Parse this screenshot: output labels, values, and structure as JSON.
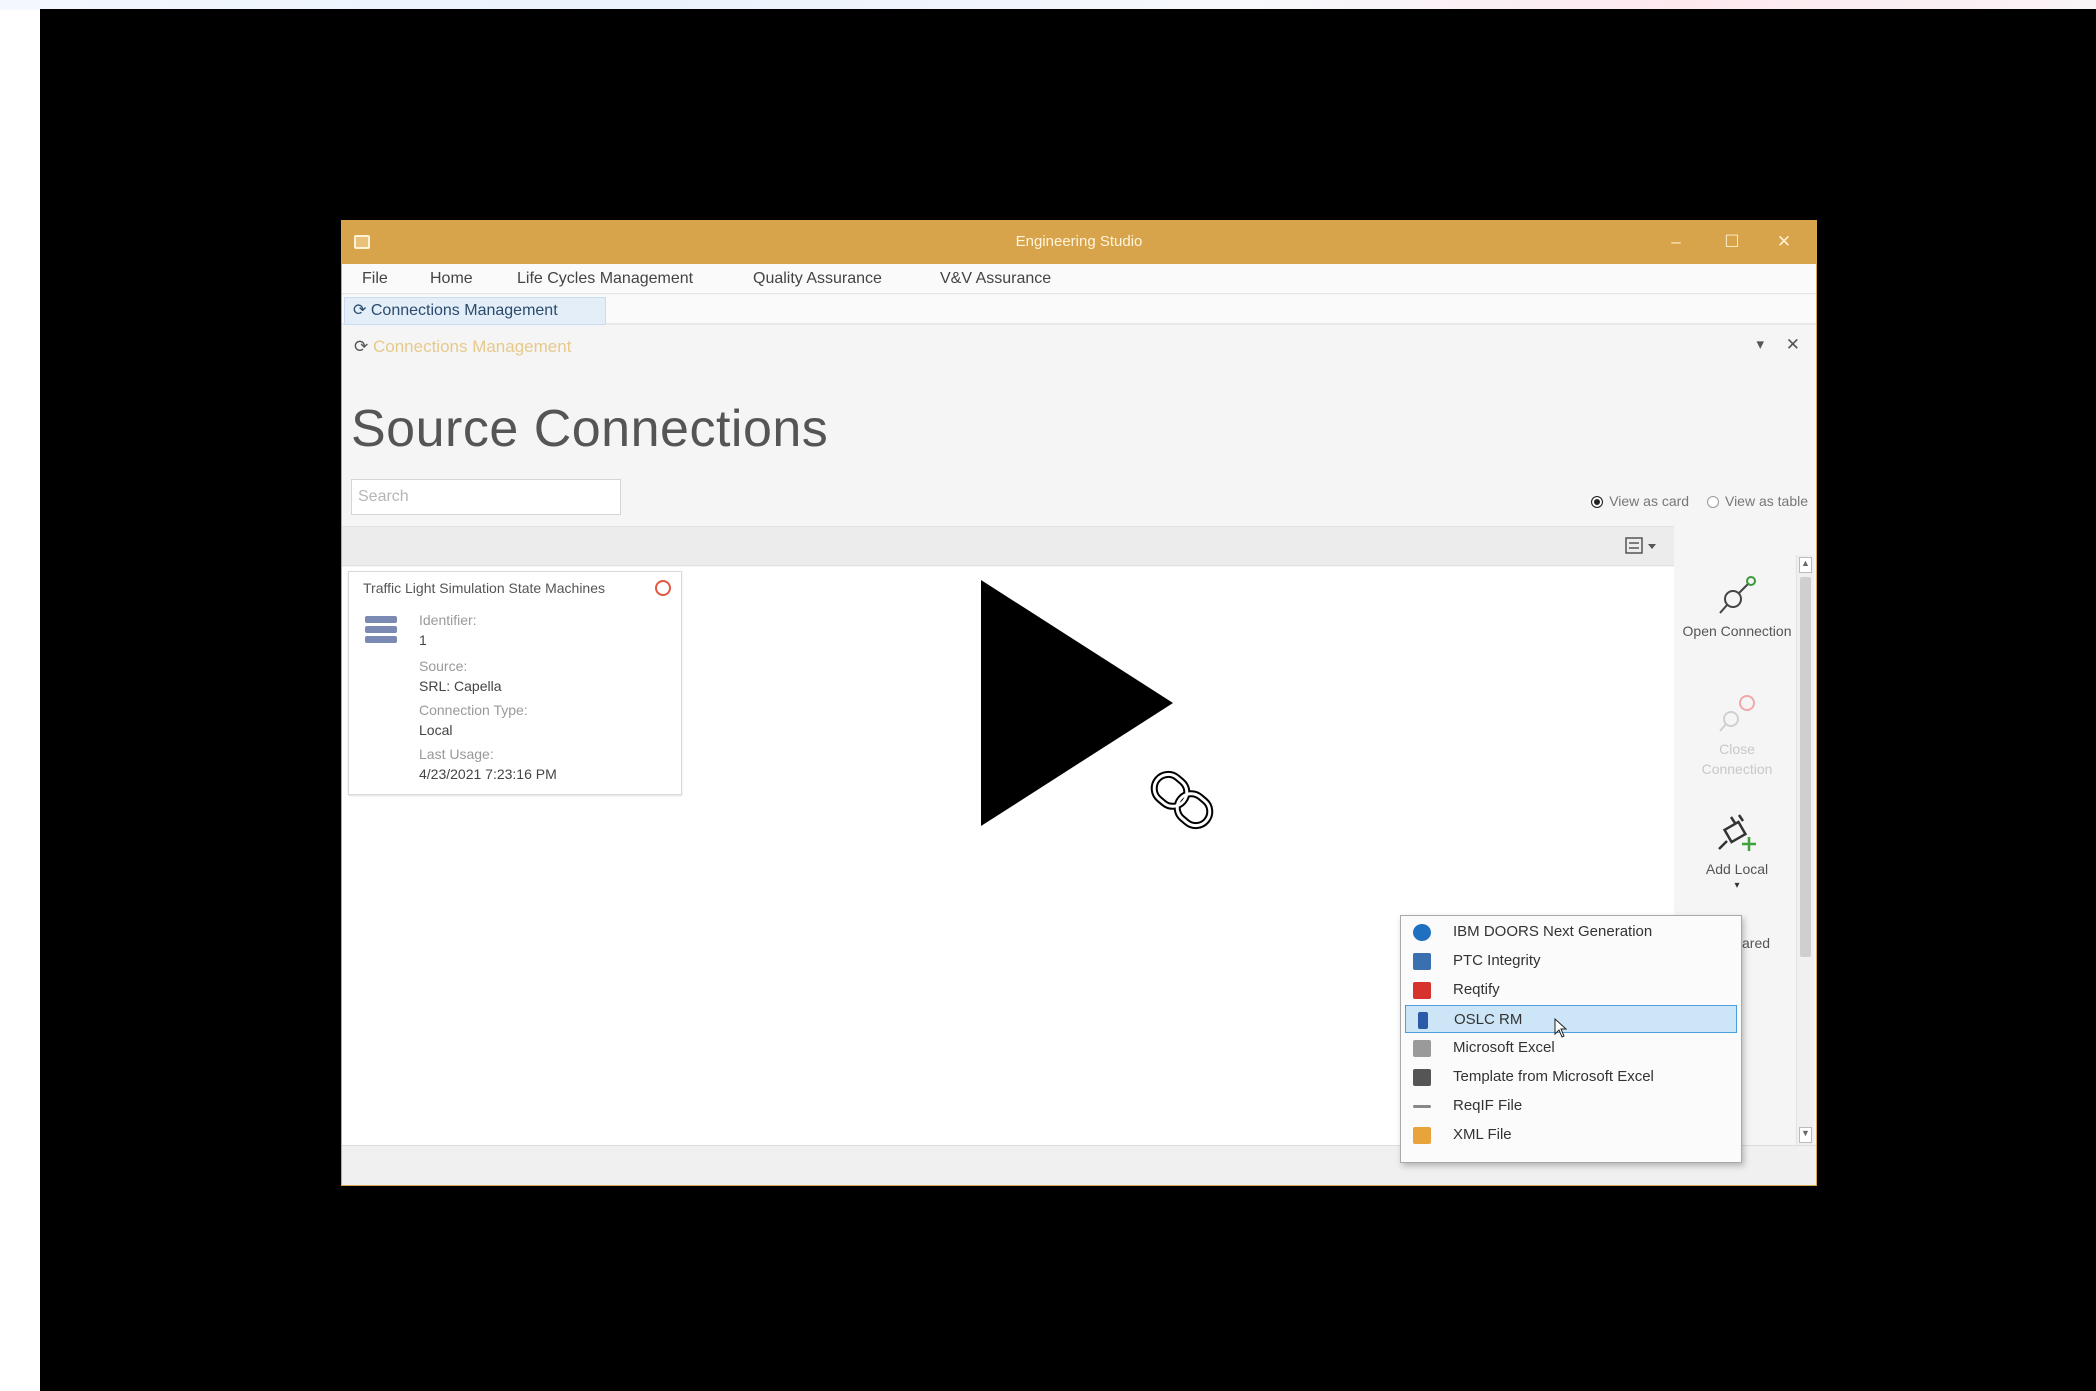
{
  "window": {
    "title": "Engineering Studio",
    "controls": {
      "minimize": "–",
      "maximize": "☐",
      "close": "✕"
    }
  },
  "menu": [
    "File",
    "Home",
    "Life Cycles Management",
    "Quality Assurance",
    "V&V Assurance"
  ],
  "active_tab": "Connections Management",
  "doc_header": {
    "title": "Connections Management",
    "pin": "▾",
    "close": "✕"
  },
  "page_title": "Source Connections",
  "search": {
    "placeholder": "Search"
  },
  "view_mode": {
    "card_label": "View as card",
    "table_label": "View as table",
    "selected": "card"
  },
  "card": {
    "title": "Traffic Light Simulation State Machines",
    "identifier_label": "Identifier:",
    "identifier_value": "1",
    "source_label": "Source:",
    "source_value": "SRL: Capella",
    "connection_type_label": "Connection Type:",
    "connection_type_value": "Local",
    "last_usage_label": "Last Usage:",
    "last_usage_value": "4/23/2021 7:23:16 PM"
  },
  "commands": [
    {
      "label": "Open Connection",
      "icon": "plug-connect-icon",
      "enabled": true
    },
    {
      "label": "Close Connection",
      "icon": "plug-disconnect-icon",
      "enabled": false
    },
    {
      "label": "Add Local",
      "icon": "plug-add-icon",
      "enabled": true
    }
  ],
  "partial_command_label": "ared",
  "dropdown": {
    "items": [
      {
        "label": "IBM DOORS Next Generation",
        "icon": "ibm-doors-icon",
        "color": "#1f70c1"
      },
      {
        "label": "PTC Integrity",
        "icon": "ptc-integrity-icon",
        "color": "#3a6fb0"
      },
      {
        "label": "Reqtify",
        "icon": "reqtify-icon",
        "color": "#d6322e"
      },
      {
        "label": "OSLC RM",
        "icon": "oslc-icon",
        "color": "#2a5aa8",
        "selected": true
      },
      {
        "label": "Microsoft Excel",
        "icon": "excel-icon",
        "color": "#777777"
      },
      {
        "label": "Template from Microsoft Excel",
        "icon": "excel-template-icon",
        "color": "#555555"
      },
      {
        "label": "ReqIF File",
        "icon": "reqif-icon",
        "color": "#888888"
      },
      {
        "label": "XML File",
        "icon": "xml-file-icon",
        "color": "#e8a43a"
      }
    ]
  },
  "overlay": {
    "play_icon": "play-icon",
    "link_icon": "link-icon"
  },
  "colors": {
    "titlebar": "#d7a44b",
    "frame": "#000000",
    "selection": "#cde6f7"
  }
}
